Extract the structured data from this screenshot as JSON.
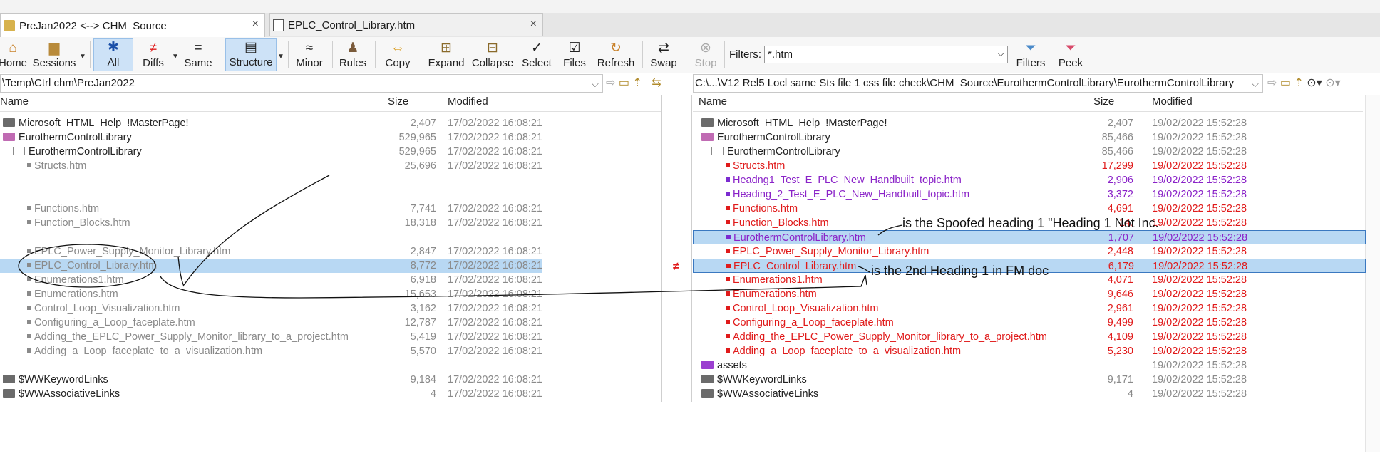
{
  "tabs": [
    {
      "label": "PreJan2022 <--> CHM_Source",
      "close": "×"
    },
    {
      "label": "EPLC_Control_Library.htm",
      "close": "×"
    }
  ],
  "toolbar": {
    "home": "Home",
    "sessions": "Sessions",
    "all": "All",
    "diffs": "Diffs",
    "same": "Same",
    "structure": "Structure",
    "minor": "Minor",
    "rules": "Rules",
    "copy": "Copy",
    "expand": "Expand",
    "collapse": "Collapse",
    "select": "Select",
    "files": "Files",
    "refresh": "Refresh",
    "swap": "Swap",
    "stop": "Stop",
    "filters_label": "Filters:",
    "filters_value": "*.htm",
    "filters_btn": "Filters",
    "peek": "Peek"
  },
  "left_path": "\\Temp\\Ctrl chm\\PreJan2022",
  "right_path": "C:\\...\\V12 Rel5 Locl same Sts file 1 css file check\\CHM_Source\\EurothermControlLibrary\\EurothermControlLibrary",
  "headers": {
    "name": "Name",
    "size": "Size",
    "modified": "Modified"
  },
  "left_rows": [
    {
      "name": "Microsoft_HTML_Help_!MasterPage!",
      "size": "2,407",
      "modified": "17/02/2022 16:08:21"
    },
    {
      "name": "EurothermControlLibrary",
      "size": "529,965",
      "modified": "17/02/2022 16:08:21"
    },
    {
      "name": "EurothermControlLibrary",
      "size": "529,965",
      "modified": "17/02/2022 16:08:21"
    },
    {
      "name": "Structs.htm",
      "size": "25,696",
      "modified": "17/02/2022 16:08:21"
    },
    {
      "name": "Functions.htm",
      "size": "7,741",
      "modified": "17/02/2022 16:08:21"
    },
    {
      "name": "Function_Blocks.htm",
      "size": "18,318",
      "modified": "17/02/2022 16:08:21"
    },
    {
      "name": "EPLC_Power_Supply_Monitor_Library.htm",
      "size": "2,847",
      "modified": "17/02/2022 16:08:21"
    },
    {
      "name": "EPLC_Control_Library.htm",
      "size": "8,772",
      "modified": "17/02/2022 16:08:21"
    },
    {
      "name": "Enumerations1.htm",
      "size": "6,918",
      "modified": "17/02/2022 16:08:21"
    },
    {
      "name": "Enumerations.htm",
      "size": "15,653",
      "modified": "17/02/2022 16:08:21"
    },
    {
      "name": "Control_Loop_Visualization.htm",
      "size": "3,162",
      "modified": "17/02/2022 16:08:21"
    },
    {
      "name": "Configuring_a_Loop_faceplate.htm",
      "size": "12,787",
      "modified": "17/02/2022 16:08:21"
    },
    {
      "name": "Adding_the_EPLC_Power_Supply_Monitor_library_to_a_project.htm",
      "size": "5,419",
      "modified": "17/02/2022 16:08:21"
    },
    {
      "name": "Adding_a_Loop_faceplate_to_a_visualization.htm",
      "size": "5,570",
      "modified": "17/02/2022 16:08:21"
    },
    {
      "name": "$WWKeywordLinks",
      "size": "9,184",
      "modified": "17/02/2022 16:08:21"
    },
    {
      "name": "$WWAssociativeLinks",
      "size": "4",
      "modified": "17/02/2022 16:08:21"
    }
  ],
  "right_rows": [
    {
      "name": "Microsoft_HTML_Help_!MasterPage!",
      "size": "2,407",
      "modified": "19/02/2022 15:52:28"
    },
    {
      "name": "EurothermControlLibrary",
      "size": "85,466",
      "modified": "19/02/2022 15:52:28"
    },
    {
      "name": "EurothermControlLibrary",
      "size": "85,466",
      "modified": "19/02/2022 15:52:28"
    },
    {
      "name": "Structs.htm",
      "size": "17,299",
      "modified": "19/02/2022 15:52:28"
    },
    {
      "name": "Headng1_Test_E_PLC_New_Handbuilt_topic.htm",
      "size": "2,906",
      "modified": "19/02/2022 15:52:28"
    },
    {
      "name": "Heading_2_Test_E_PLC_New_Handbuilt_topic.htm",
      "size": "3,372",
      "modified": "19/02/2022 15:52:28"
    },
    {
      "name": "Functions.htm",
      "size": "4,691",
      "modified": "19/02/2022 15:52:28"
    },
    {
      "name": "Function_Blocks.htm",
      "size": "14,",
      "modified": "19/02/2022 15:52:28"
    },
    {
      "name": "EurothermControlLibrary.htm",
      "size": "1,707",
      "modified": "19/02/2022 15:52:28"
    },
    {
      "name": "EPLC_Power_Supply_Monitor_Library.htm",
      "size": "2,448",
      "modified": "19/02/2022 15:52:28"
    },
    {
      "name": "EPLC_Control_Library.htm",
      "size": "6,179",
      "modified": "19/02/2022 15:52:28"
    },
    {
      "name": "Enumerations1.htm",
      "size": "4,071",
      "modified": "19/02/2022 15:52:28"
    },
    {
      "name": "Enumerations.htm",
      "size": "9,646",
      "modified": "19/02/2022 15:52:28"
    },
    {
      "name": "Control_Loop_Visualization.htm",
      "size": "2,961",
      "modified": "19/02/2022 15:52:28"
    },
    {
      "name": "Configuring_a_Loop_faceplate.htm",
      "size": "9,499",
      "modified": "19/02/2022 15:52:28"
    },
    {
      "name": "Adding_the_EPLC_Power_Supply_Monitor_library_to_a_project.htm",
      "size": "4,109",
      "modified": "19/02/2022 15:52:28"
    },
    {
      "name": "Adding_a_Loop_faceplate_to_a_visualization.htm",
      "size": "5,230",
      "modified": "19/02/2022 15:52:28"
    },
    {
      "name": "assets",
      "size": "",
      "modified": "19/02/2022 15:52:28"
    },
    {
      "name": "$WWKeywordLinks",
      "size": "9,171",
      "modified": "19/02/2022 15:52:28"
    },
    {
      "name": "$WWAssociativeLinks",
      "size": "4",
      "modified": "19/02/2022 15:52:28"
    }
  ],
  "diff_marker": "≠",
  "annotations": {
    "spoofed": "is the Spoofed heading 1 \"Heading 1 Not Inc.",
    "second": "is the 2nd Heading 1 in FM doc"
  },
  "colors": {
    "red": "#e01a1a",
    "purple": "#8a22c8",
    "selection": "#b8d8f3"
  }
}
